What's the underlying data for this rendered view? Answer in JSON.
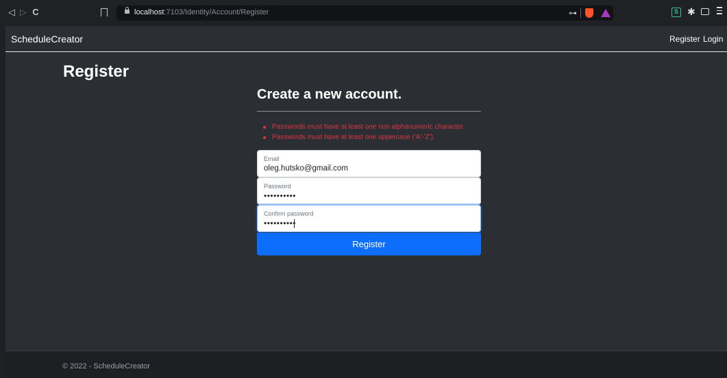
{
  "browser": {
    "url_host": "localhost",
    "url_rest": ":7103/Identity/Account/Register",
    "icons": [
      "back-icon",
      "forward-icon",
      "reload-icon",
      "bookmark-icon",
      "lock-icon",
      "key-icon",
      "brave-shield-icon",
      "rewards-icon",
      "extension-icon",
      "puzzle-icon",
      "wallet-icon",
      "menu-icon"
    ],
    "nav_glyphs": {
      "back": "◁",
      "forward": "▷",
      "reload": "C"
    },
    "ext_glyph": "S"
  },
  "site": {
    "brand": "ScheduleCreator",
    "nav": {
      "register": "Register",
      "login": "Login"
    }
  },
  "page": {
    "title": "Register",
    "heading": "Create a new account.",
    "errors": [
      "Passwords must have at least one non alphanumeric character.",
      "Passwords must have at least one uppercase ('A'-'Z')."
    ],
    "fields": {
      "email": {
        "label": "Email",
        "value": "oleg.hutsko@gmail.com"
      },
      "password": {
        "label": "Password",
        "value": "••••••••••"
      },
      "confirm": {
        "label": "Confirm password",
        "value": "••••••••••"
      }
    },
    "submit_label": "Register"
  },
  "footer": {
    "text": "© 2022 - ScheduleCreator"
  },
  "colors": {
    "primary": "#0d6efd",
    "error": "#dc3545",
    "background": "#2b2e33"
  }
}
